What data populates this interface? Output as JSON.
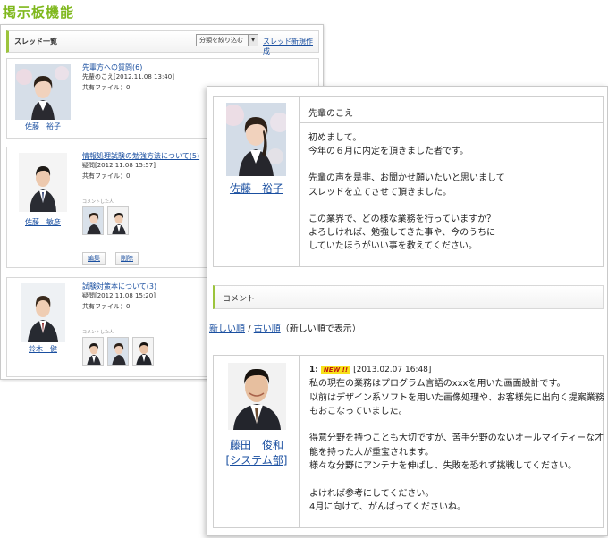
{
  "page_title": "掲示板機能",
  "thread_list": {
    "title": "スレッド一覧",
    "filter_label": "分類を絞り込む",
    "new_thread_link": "スレッド新規作成",
    "commenters_label": "コメントした人",
    "edit_label": "編集",
    "delete_label": "削除",
    "threads": [
      {
        "title": "先輩方への質問(6)",
        "meta": "先輩のこえ[2012.11.08 13:40]",
        "files": "共有ファイル：0",
        "author": "佐藤　裕子"
      },
      {
        "title": "情報処理試験の勉強方法について(5)",
        "meta": "疑問[2012.11.08 15:57]",
        "files": "共有ファイル：0",
        "author": "佐藤　敏彦"
      },
      {
        "title": "試験対策本について(3)",
        "meta": "疑問[2012.11.08 15:20]",
        "files": "共有ファイル：0",
        "author": "鈴木　健"
      }
    ]
  },
  "post": {
    "author_name": "佐藤　裕子",
    "category": "先輩のこえ",
    "body": [
      "初めまして。\n今年の６月に内定を頂きました者です。",
      "先輩の声を是非、お聞かせ願いたいと思いまして\nスレッドを立てさせて頂きました。",
      "この業界で、どの様な業務を行っていますか？\nよろしければ、勉強してきた事や、今のうちに\nしていたほうがいい事を教えてください。"
    ]
  },
  "comments_section": {
    "title": "コメント",
    "sort_new": "新しい順",
    "sort_separator": " / ",
    "sort_old": "古い順",
    "sort_note": "（新しい順で表示）"
  },
  "comment": {
    "number": "1:",
    "badge": "NEW !!",
    "timestamp": "[2013.02.07 16:48]",
    "author_name": "藤田　俊和",
    "author_dept": "[システム部]",
    "body": [
      "私の現在の業務はプログラム言語のxxxを用いた画面設計です。\n以前はデザイン系ソフトを用いた画像処理や、お客様先に出向く提案業務\nもおこなっていました。",
      "得意分野を持つことも大切ですが、苦手分野のないオールマイティーな才\n能を持った人が重宝されます。\n様々な分野にアンテナを伸ばし、失敗を恐れず挑戦してください。",
      "よければ参考にしてください。\n4月に向けて、がんばってくださいね。"
    ]
  },
  "colors": {
    "accent_green": "#7fb81d",
    "link_blue": "#1a4fa0",
    "badge_yellow": "#f7e11a",
    "badge_red": "#c0140f"
  }
}
